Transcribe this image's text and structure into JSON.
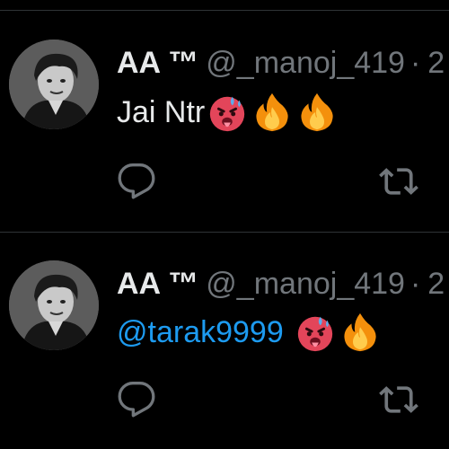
{
  "tweets": [
    {
      "display_name": "AA ™",
      "handle": "@_manoj_419",
      "separator": "·",
      "time": "2",
      "text": "Jai Ntr",
      "mention": "",
      "emojis": [
        "hot-face-emoji",
        "fire-emoji",
        "fire-emoji"
      ]
    },
    {
      "display_name": "AA ™",
      "handle": "@_manoj_419",
      "separator": "·",
      "time": "2",
      "text": "",
      "mention": "@tarak9999",
      "emojis": [
        "hot-face-emoji",
        "fire-emoji"
      ]
    }
  ],
  "icons": {
    "reply": "reply-icon",
    "retweet": "retweet-icon"
  },
  "colors": {
    "background": "#000000",
    "text": "#e7e9ea",
    "muted": "#71767b",
    "link": "#1d9bf0",
    "divider": "#2f3336"
  }
}
